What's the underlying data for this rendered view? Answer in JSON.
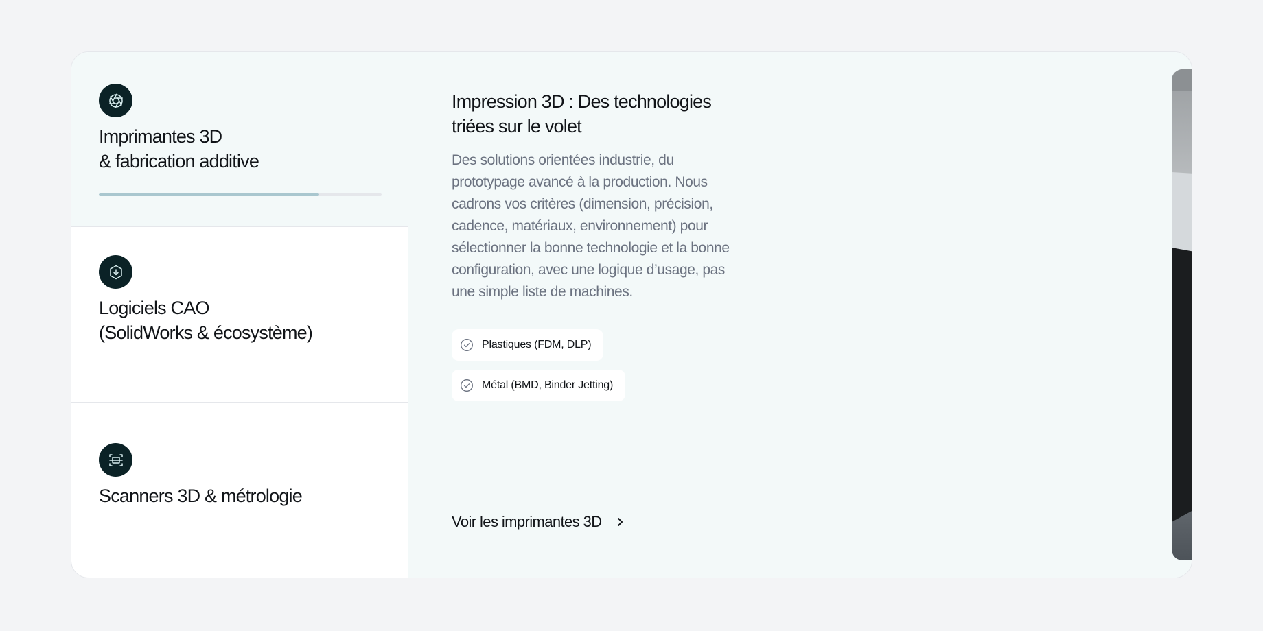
{
  "sidebar": {
    "items": [
      {
        "title": "Imprimantes 3D\n& fabrication additive",
        "icon": "aperture-icon",
        "active": true,
        "progress": 0.78
      },
      {
        "title": "Logiciels CAO\n(SolidWorks & écosystème)",
        "icon": "download-cube-icon",
        "active": false
      },
      {
        "title": "Scanners 3D & métrologie",
        "icon": "scan-icon",
        "active": false
      }
    ]
  },
  "content": {
    "title": "Impression  3D : Des technologies triées sur le volet",
    "description": "Des solutions orientées industrie, du prototypage avancé à la production. Nous cadrons vos critères (dimension, précision, cadence, matériaux, environnement) pour sélectionner la bonne technologie et la bonne configuration, avec une logique d’usage, pas une simple liste de machines.",
    "tags": [
      {
        "label": "Plastiques (FDM, DLP)",
        "icon": "check-circle-icon"
      },
      {
        "label": "Métal (BMD, Binder Jetting)",
        "icon": "check-circle-icon"
      }
    ],
    "cta_label": "Voir les imprimantes 3D",
    "image": "3d-printer-factory-photo"
  },
  "colors": {
    "page_bg": "#f3f4f6",
    "active_bg": "#f3f9f9",
    "icon_bg": "#0b2226",
    "progress_fill": "#a9c7cf",
    "muted_text": "#6b7280"
  }
}
